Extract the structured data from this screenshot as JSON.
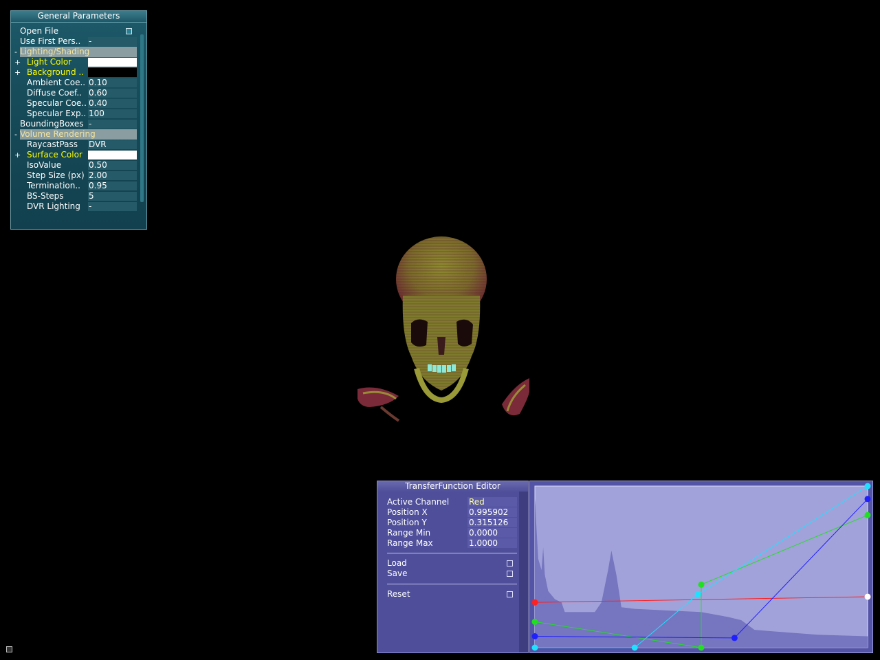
{
  "general_parameters": {
    "title": "General Parameters",
    "rows": [
      {
        "toggle": "",
        "label": "Open File",
        "value": "",
        "kind": "button",
        "indent": 0
      },
      {
        "toggle": "",
        "label": "Use First Pers..",
        "value": "-",
        "kind": "value",
        "indent": 0
      },
      {
        "toggle": "-",
        "label": "Lighting/Shading",
        "value": "",
        "kind": "section",
        "indent": 0
      },
      {
        "toggle": "+",
        "label": "Light Color",
        "value": "",
        "kind": "color-white",
        "indent": 1
      },
      {
        "toggle": "+",
        "label": "Background ..",
        "value": "",
        "kind": "color-black",
        "indent": 1
      },
      {
        "toggle": "",
        "label": "Ambient Coe..",
        "value": "0.10",
        "kind": "value",
        "indent": 1
      },
      {
        "toggle": "",
        "label": "Diffuse Coef..",
        "value": "0.60",
        "kind": "value",
        "indent": 1
      },
      {
        "toggle": "",
        "label": "Specular Coe..",
        "value": "0.40",
        "kind": "value",
        "indent": 1
      },
      {
        "toggle": "",
        "label": "Specular Exp..",
        "value": "100",
        "kind": "value",
        "indent": 1
      },
      {
        "toggle": "",
        "label": "BoundingBoxes",
        "value": "-",
        "kind": "value",
        "indent": 0
      },
      {
        "toggle": "-",
        "label": "Volume Rendering",
        "value": "",
        "kind": "section",
        "indent": 0
      },
      {
        "toggle": "",
        "label": "RaycastPass",
        "value": "DVR",
        "kind": "value",
        "indent": 1
      },
      {
        "toggle": "+",
        "label": "Surface Color",
        "value": "",
        "kind": "color-white",
        "indent": 1
      },
      {
        "toggle": "",
        "label": "IsoValue",
        "value": "0.50",
        "kind": "value",
        "indent": 1
      },
      {
        "toggle": "",
        "label": "Step Size (px)",
        "value": "2.00",
        "kind": "value",
        "indent": 1
      },
      {
        "toggle": "",
        "label": "Termination..",
        "value": "0.95",
        "kind": "value",
        "indent": 1
      },
      {
        "toggle": "",
        "label": "BS-Steps",
        "value": "5",
        "kind": "value",
        "indent": 1
      },
      {
        "toggle": "",
        "label": "DVR Lighting",
        "value": "-",
        "kind": "value",
        "indent": 1
      }
    ]
  },
  "transfer_function": {
    "title": "TransferFunction Editor",
    "fields": [
      {
        "label": "Active Channel",
        "value": "Red"
      },
      {
        "label": "Position X",
        "value": "0.995902"
      },
      {
        "label": "Position Y",
        "value": "0.315126"
      },
      {
        "label": "Range Min",
        "value": "0.0000"
      },
      {
        "label": "Range Max",
        "value": "1.0000"
      }
    ],
    "buttons": {
      "load": "Load",
      "save": "Save",
      "reset": "Reset"
    },
    "active_channel_color": "#ffff99",
    "curves": {
      "red": {
        "color": "#ff2020",
        "points": [
          [
            0.0,
            0.28
          ],
          [
            1.0,
            0.315
          ]
        ]
      },
      "green": {
        "color": "#20e020",
        "points": [
          [
            0.0,
            0.16
          ],
          [
            0.5,
            0.0
          ],
          [
            0.5,
            0.39
          ],
          [
            1.0,
            0.82
          ]
        ]
      },
      "blue": {
        "color": "#2020ff",
        "points": [
          [
            0.0,
            0.07
          ],
          [
            0.6,
            0.06
          ],
          [
            1.0,
            0.92
          ]
        ]
      },
      "cyan": {
        "color": "#20e0ff",
        "points": [
          [
            0.0,
            0.0
          ],
          [
            0.3,
            0.0
          ],
          [
            0.49,
            0.33
          ],
          [
            1.0,
            1.0
          ]
        ]
      }
    },
    "marker_end": {
      "color": "#ffffff",
      "point": [
        1.0,
        0.315
      ]
    }
  },
  "colors": {
    "panel_teal": "#1d5a6a",
    "label_yellow": "#ffff00",
    "tf_panel": "#4e4e9a",
    "tf_graph_bg": "#a0a0d8",
    "tf_histogram": "#7272be"
  }
}
